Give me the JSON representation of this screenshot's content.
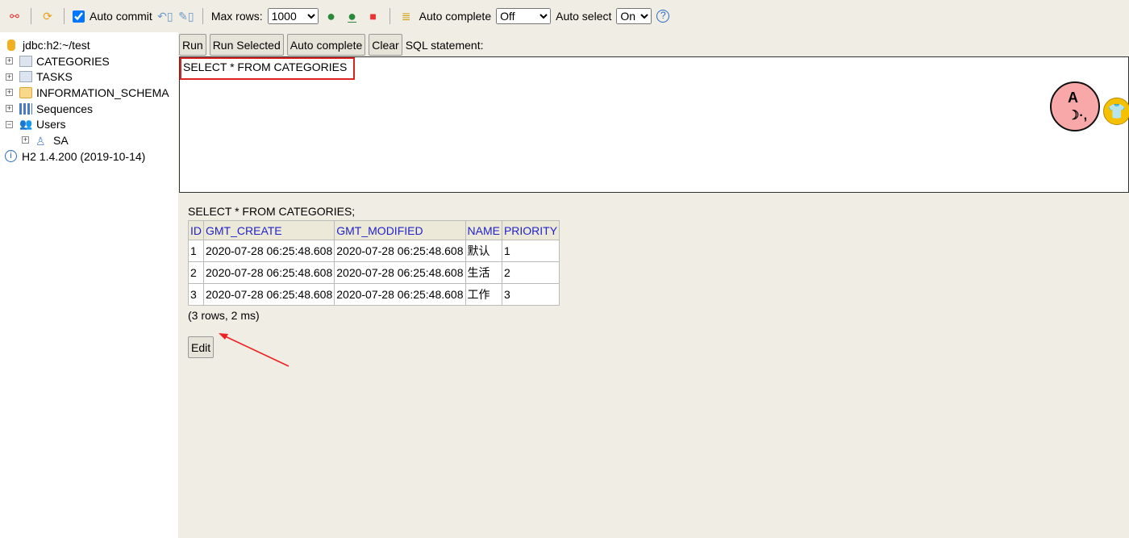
{
  "toolbar": {
    "auto_commit_label": "Auto commit",
    "auto_commit_checked": true,
    "max_rows_label": "Max rows:",
    "max_rows_value": "1000",
    "auto_complete_label": "Auto complete",
    "auto_complete_value": "Off",
    "auto_select_label": "Auto select",
    "auto_select_value": "On",
    "help": "?"
  },
  "sidebar": {
    "connection": "jdbc:h2:~/test",
    "items": [
      {
        "label": "CATEGORIES",
        "icon": "table-icon"
      },
      {
        "label": "TASKS",
        "icon": "table-icon"
      },
      {
        "label": "INFORMATION_SCHEMA",
        "icon": "folder-icon"
      },
      {
        "label": "Sequences",
        "icon": "sequence-icon"
      },
      {
        "label": "Users",
        "icon": "users-icon"
      }
    ],
    "user": "SA",
    "version": "H2 1.4.200 (2019-10-14)"
  },
  "buttons": {
    "run": "Run",
    "run_selected": "Run Selected",
    "auto_complete": "Auto complete",
    "clear": "Clear",
    "sql_label": "SQL statement:"
  },
  "editor": {
    "text": "SELECT * FROM CATEGORIES"
  },
  "result": {
    "query": "SELECT * FROM CATEGORIES;",
    "columns": [
      "ID",
      "GMT_CREATE",
      "GMT_MODIFIED",
      "NAME",
      "PRIORITY"
    ],
    "rows": [
      [
        "1",
        "2020-07-28 06:25:48.608",
        "2020-07-28 06:25:48.608",
        "默认",
        "1"
      ],
      [
        "2",
        "2020-07-28 06:25:48.608",
        "2020-07-28 06:25:48.608",
        "生活",
        "2"
      ],
      [
        "3",
        "2020-07-28 06:25:48.608",
        "2020-07-28 06:25:48.608",
        "工作",
        "3"
      ]
    ],
    "summary": "(3 rows, 2 ms)",
    "edit": "Edit"
  },
  "colors": {
    "background": "#f0ede4",
    "header_text": "#2222cc",
    "highlight": "#dd2222"
  }
}
